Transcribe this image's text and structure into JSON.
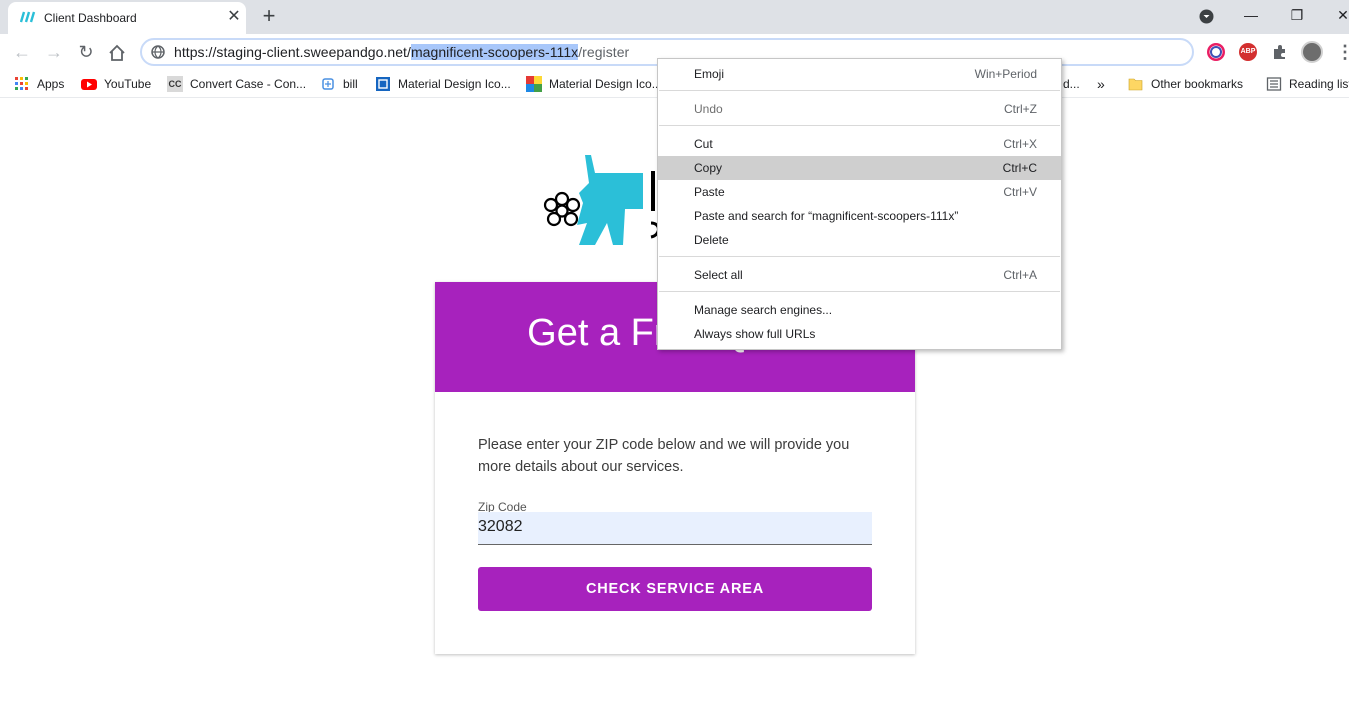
{
  "tab": {
    "title": "Client Dashboard",
    "close": "✕"
  },
  "toolbar": {
    "url_base": "https://staging-client.sweepandgo.net/",
    "url_selected": "magnificent-scoopers-111x",
    "url_rest": "/register",
    "ext_abp": "ABP"
  },
  "bookmarks": [
    {
      "label": "Apps",
      "icon": "apps-grid-icon"
    },
    {
      "label": "YouTube",
      "icon": "youtube-icon"
    },
    {
      "label": "Convert Case - Con...",
      "icon": "cc-icon"
    },
    {
      "label": "bill",
      "icon": "bill-icon"
    },
    {
      "label": "Material Design Ico...",
      "icon": "material-design-icon"
    },
    {
      "label": "Material Design Ico...",
      "icon": "material-colors-icon"
    },
    {
      "label": "d...",
      "icon": ""
    },
    {
      "label": "»",
      "icon": ""
    },
    {
      "label": "Other bookmarks",
      "icon": "folder-icon"
    },
    {
      "label": "Reading list",
      "icon": "reading-list-icon"
    }
  ],
  "page": {
    "title": "Get a Free Quote",
    "description": "Please enter your ZIP code below and we will provide you more details about our services.",
    "zip_label": "Zip Code",
    "zip_value": "32082",
    "check_button": "CHECK SERVICE AREA"
  },
  "context_menu": {
    "items": [
      {
        "label": "Emoji",
        "shortcut": "Win+Period"
      },
      {
        "label": "Undo",
        "shortcut": "Ctrl+Z"
      },
      {
        "label": "Cut",
        "shortcut": "Ctrl+X"
      },
      {
        "label": "Copy",
        "shortcut": "Ctrl+C"
      },
      {
        "label": "Paste",
        "shortcut": "Ctrl+V"
      },
      {
        "label": "Paste and search for “magnificent-scoopers-111x”",
        "shortcut": ""
      },
      {
        "label": "Delete",
        "shortcut": ""
      },
      {
        "label": "Select all",
        "shortcut": "Ctrl+A"
      },
      {
        "label": "Manage search engines...",
        "shortcut": ""
      },
      {
        "label": "Always show full URLs",
        "shortcut": ""
      }
    ]
  },
  "colors": {
    "brand_purple": "#a722bd",
    "logo_teal": "#2bbfd8",
    "selection": "#a8c7fa"
  }
}
